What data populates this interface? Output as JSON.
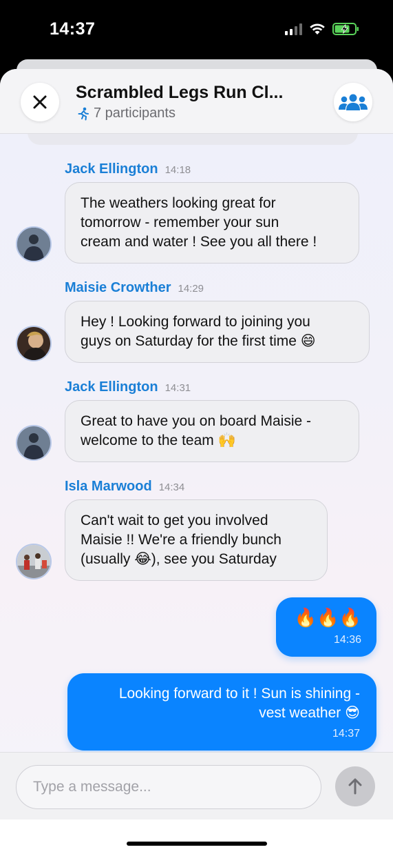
{
  "status_bar": {
    "time": "14:37"
  },
  "header": {
    "title": "Scrambled Legs Run Cl...",
    "participants": "7 participants"
  },
  "messages": [
    {
      "sender": "Jack Ellington",
      "time": "14:18",
      "lines": [
        "The weathers looking great for",
        "tomorrow - remember your sun",
        "cream and water ! See you all there !"
      ]
    },
    {
      "sender": "Maisie Crowther",
      "time": "14:29",
      "lines": [
        "Hey ! Looking forward to joining you",
        "guys on Saturday for the first time 😄"
      ]
    },
    {
      "sender": "Jack Ellington",
      "time": "14:31",
      "lines": [
        "Great to have you on board Maisie -",
        "welcome to the team 🙌"
      ]
    },
    {
      "sender": "Isla Marwood",
      "time": "14:34",
      "lines": [
        "Can't wait to get you involved",
        "Maisie !! We're a friendly bunch",
        "(usually 😂), see you Saturday"
      ]
    }
  ],
  "outgoing": [
    {
      "text": "🔥🔥🔥",
      "time": "14:36"
    },
    {
      "lines": [
        "Looking forward to it ! Sun is shining -",
        "vest weather 😎"
      ],
      "time": "14:37"
    }
  ],
  "composer": {
    "placeholder": "Type a message..."
  },
  "colors": {
    "accent": "#0a84ff",
    "sender_name": "#1a7fd6"
  },
  "icons": [
    "close-icon",
    "runner-icon",
    "group-icon",
    "send-arrow-icon",
    "wifi-icon",
    "battery-icon",
    "signal-icon"
  ]
}
